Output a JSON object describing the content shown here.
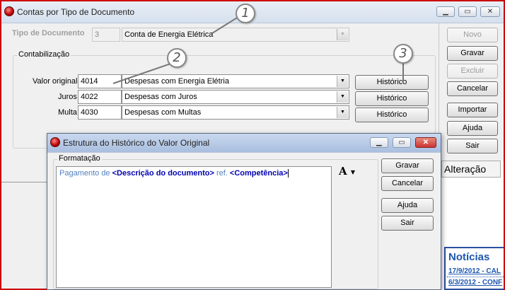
{
  "main": {
    "title": "Contas por Tipo de Documento",
    "controls": {
      "minimize": "▁",
      "maximize": "▭",
      "close": "✕"
    },
    "tipo_documento": {
      "label": "Tipo de Documento",
      "code": "3",
      "value": "Conta de Energia Elétrica"
    },
    "contabilizacao": {
      "label": "Contabilização",
      "rows": [
        {
          "label": "Valor original",
          "code": "4014",
          "value": "Despesas com Energia Elétria",
          "button": "Histórico"
        },
        {
          "label": "Juros",
          "code": "4022",
          "value": "Despesas com Juros",
          "button": "Histórico"
        },
        {
          "label": "Multa",
          "code": "4030",
          "value": "Despesas com Multas",
          "button": "Histórico"
        }
      ]
    },
    "buttons": {
      "novo": "Novo",
      "gravar": "Gravar",
      "excluir": "Excluir",
      "cancelar": "Cancelar",
      "importar": "Importar",
      "ajuda": "Ajuda",
      "sair": "Sair"
    }
  },
  "callouts": [
    "1",
    "2",
    "3"
  ],
  "dialog": {
    "title": "Estrutura do Histórico do Valor Original",
    "controls": {
      "minimize": "▁",
      "maximize": "▭",
      "close": "✕"
    },
    "formatacao_label": "Formatação",
    "text_parts": [
      "Pagamento de ",
      "<Descrição do documento>",
      " ref. ",
      "<Competência>"
    ],
    "font_button": "A",
    "buttons": {
      "gravar": "Gravar",
      "cancelar": "Cancelar",
      "ajuda": "Ajuda",
      "sair": "Sair"
    }
  },
  "side_panel": {
    "header": "Alteração",
    "news_title": "Notícias",
    "news_items": [
      "17/9/2012 - CAL",
      "6/3/2012 - CONF"
    ]
  },
  "colors": {
    "window_border": "#cc0000",
    "news_blue": "#1d56b0",
    "tag_blue": "#0000b0",
    "literal_blue": "#4f81bd"
  }
}
